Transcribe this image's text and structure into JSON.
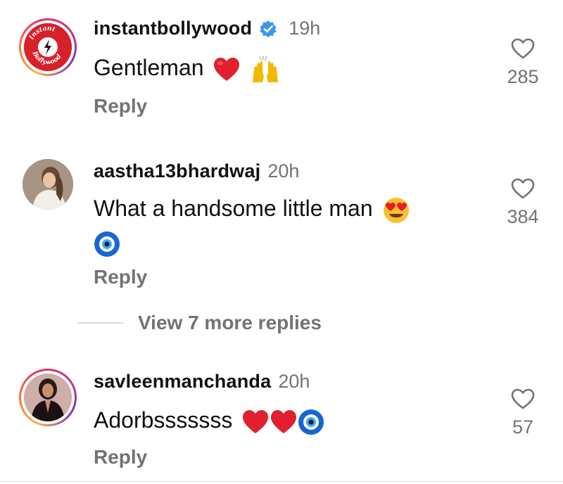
{
  "comments": [
    {
      "username": "instantbollywood",
      "verified": true,
      "time": "19h",
      "text": "Gentleman",
      "emojis": [
        "red-heart",
        "raising-hands"
      ],
      "reply_label": "Reply",
      "likes": "285",
      "avatar_logo_top": "Instant",
      "avatar_logo_bottom": "Bollywood"
    },
    {
      "username": "aastha13bhardwaj",
      "verified": false,
      "time": "20h",
      "text_line1": "What a handsome little man",
      "emojis": [
        "smiling-face-with-heart-eyes",
        "nazar-amulet"
      ],
      "reply_label": "Reply",
      "likes": "384"
    },
    {
      "username": "savleenmanchanda",
      "verified": false,
      "time": "20h",
      "text": "Adorbsssssss",
      "emojis": [
        "red-heart",
        "red-heart",
        "nazar-amulet"
      ],
      "reply_label": "Reply",
      "likes": "57"
    }
  ],
  "view_more_replies": "View 7 more replies",
  "colors": {
    "text": "#111111",
    "secondary": "#737373",
    "verified": "#3897f0",
    "heart": "#e0202e"
  }
}
